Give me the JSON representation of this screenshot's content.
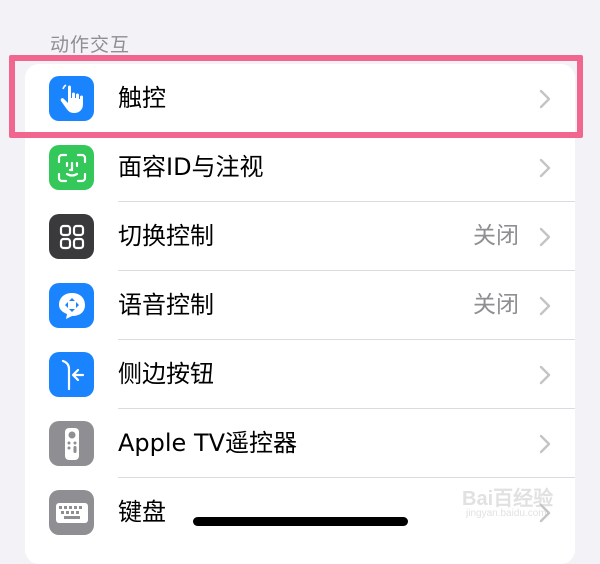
{
  "section": {
    "title": "动作交互"
  },
  "rows": [
    {
      "label": "触控",
      "value": "",
      "icon": "hand-touch-icon",
      "icon_bg": "#1a84ff"
    },
    {
      "label": "面容ID与注视",
      "value": "",
      "icon": "face-id-icon",
      "icon_bg": "#34c759"
    },
    {
      "label": "切换控制",
      "value": "关闭",
      "icon": "switch-control-icon",
      "icon_bg": "#3a3a3c"
    },
    {
      "label": "语音控制",
      "value": "关闭",
      "icon": "voice-control-icon",
      "icon_bg": "#1a84ff"
    },
    {
      "label": "侧边按钮",
      "value": "",
      "icon": "side-button-icon",
      "icon_bg": "#1a84ff"
    },
    {
      "label": "Apple TV遥控器",
      "value": "",
      "icon": "apple-tv-remote-icon",
      "icon_bg": "#8e8e93"
    },
    {
      "label": "键盘",
      "value": "",
      "icon": "keyboard-icon",
      "icon_bg": "#8e8e93"
    }
  ],
  "watermark": {
    "logo": "Bai百经验",
    "sub": "jingyan.baidu.com"
  },
  "colors": {
    "highlight": "#f0668f",
    "background": "#f2f2f7",
    "secondary_text": "#8e8e93"
  }
}
